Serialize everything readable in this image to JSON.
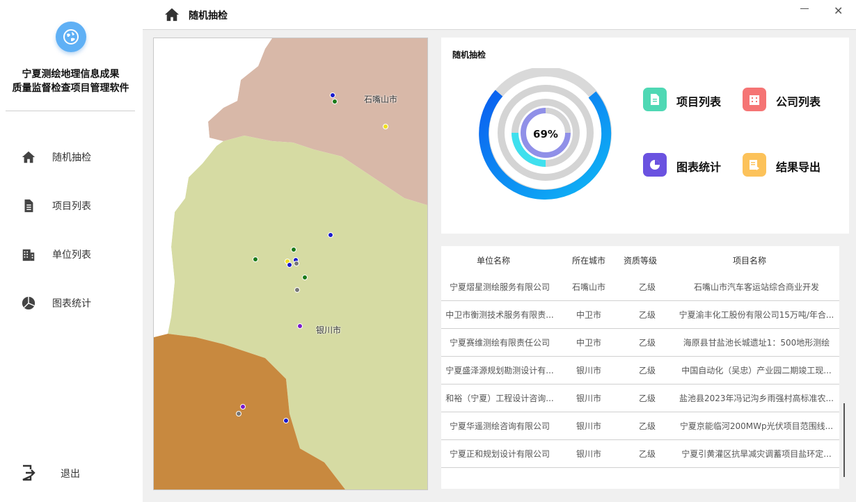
{
  "app": {
    "title_line1": "宁夏测绘地理信息成果",
    "title_line2": "质量监督检查项目管理软件"
  },
  "sidebar": {
    "items": [
      {
        "label": "随机抽检",
        "icon": "home-icon"
      },
      {
        "label": "项目列表",
        "icon": "document-icon"
      },
      {
        "label": "单位列表",
        "icon": "building-icon"
      },
      {
        "label": "图表统计",
        "icon": "pie-chart-icon"
      }
    ],
    "exit_label": "退出"
  },
  "topbar": {
    "title": "随机抽检",
    "minimize": "—",
    "close": "✕"
  },
  "map": {
    "labels": [
      "石嘴山市",
      "银川市"
    ],
    "colors": {
      "shizuishan": "#d9b8a8",
      "yinchuan": "#d6dba4",
      "south": "#c8893f"
    }
  },
  "panel": {
    "title": "随机抽检",
    "percent": "69%",
    "percent_value": 69,
    "tiles": [
      {
        "label": "项目列表",
        "color": "#4fd8b4",
        "icon": "document-icon"
      },
      {
        "label": "公司列表",
        "color": "#f57474",
        "icon": "building-icon"
      },
      {
        "label": "图表统计",
        "color": "#6a52e0",
        "icon": "pie-chart-icon"
      },
      {
        "label": "结果导出",
        "color": "#fcc25a",
        "icon": "export-icon"
      }
    ]
  },
  "table": {
    "headers": [
      "单位名称",
      "所在城市",
      "资质等级",
      "项目名称"
    ],
    "rows": [
      [
        "宁夏熠星测绘服务有限公司",
        "石嘴山市",
        "乙级",
        "石嘴山市汽车客运站综合商业开发"
      ],
      [
        "中卫市衡测技术服务有限责...",
        "中卫市",
        "乙级",
        "宁夏渝丰化工股份有限公司15万吨/年合..."
      ],
      [
        "宁夏赛维测绘有限责任公司",
        "中卫市",
        "乙级",
        "海原县甘盐池长城遗址1：500地形测绘"
      ],
      [
        "宁夏盛泽源规划勘测设计有...",
        "银川市",
        "乙级",
        "中国自动化（吴忠）产业园二期竣工现..."
      ],
      [
        "和裕（宁夏）工程设计咨询...",
        "银川市",
        "乙级",
        "盐池县2023年冯记沟乡雨强村高标准农..."
      ],
      [
        "宁夏华遥测绘咨询有限公司",
        "银川市",
        "乙级",
        "宁夏京能临河200MWp光伏项目范围线..."
      ],
      [
        "宁夏正和规划设计有限公司",
        "银川市",
        "乙级",
        "宁夏引黄灌区抗旱减灾调蓄项目盐环定..."
      ]
    ]
  }
}
